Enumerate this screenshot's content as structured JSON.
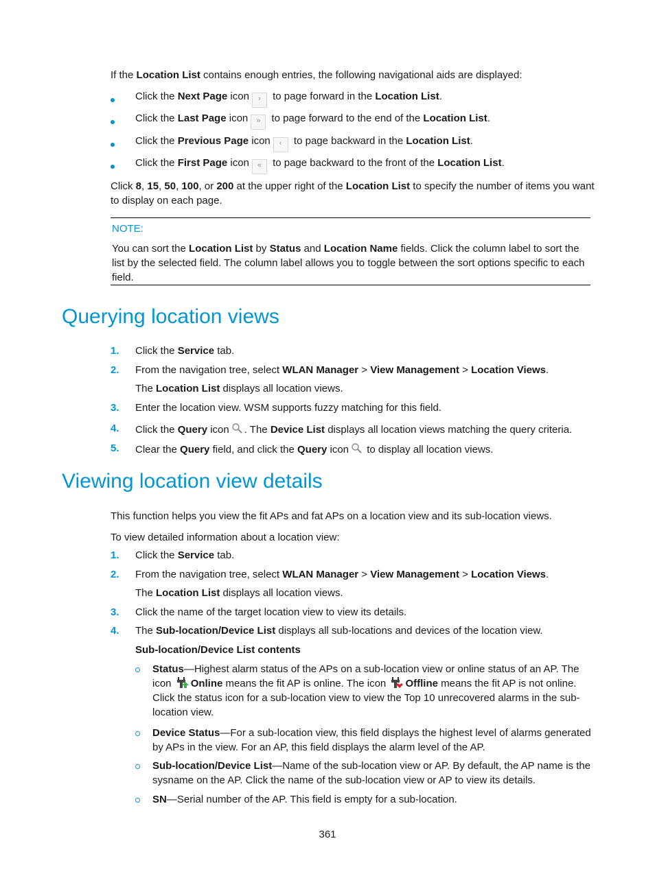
{
  "intro": {
    "pre": "If the ",
    "bold": "Location List",
    "post": " contains enough entries, the following navigational aids are displayed:"
  },
  "nav_bullets": [
    {
      "pre": "Click the ",
      "bold": "Next Page",
      "mid": " icon",
      "icon": "›",
      "icon_name": "next-page-icon",
      "post": " to page forward in the ",
      "bold2": "Location List",
      "end": "."
    },
    {
      "pre": "Click the ",
      "bold": "Last Page",
      "mid": " icon",
      "icon": "»",
      "icon_name": "last-page-icon",
      "post": " to page forward to the end of the ",
      "bold2": "Location List",
      "end": "."
    },
    {
      "pre": "Click the ",
      "bold": "Previous Page",
      "mid": " icon",
      "icon": "‹",
      "icon_name": "previous-page-icon",
      "post": " to page backward in the ",
      "bold2": "Location List",
      "end": "."
    },
    {
      "pre": "Click the ",
      "bold": "First Page",
      "mid": " icon",
      "icon": "«",
      "icon_name": "first-page-icon",
      "post": " to page backward to the front of the ",
      "bold2": "Location List",
      "end": "."
    }
  ],
  "page_size": {
    "pre": "Click ",
    "options": [
      "8",
      "15",
      "50",
      "100",
      "200"
    ],
    "or": " or ",
    "mid": " at the upper right of the ",
    "bold": "Location List",
    "post": " to specify the number of items you want to display on each page."
  },
  "note": {
    "label": "NOTE:",
    "t1": "You can sort the ",
    "b1": "Location List",
    "t2": " by ",
    "b2": "Status",
    "t3": " and ",
    "b3": "Location Name",
    "t4": " fields. Click the column label to sort the list by the selected field. The column label allows you to toggle between the sort options specific to each field."
  },
  "section1": {
    "title": "Querying location views",
    "steps": [
      {
        "num": "1.",
        "t1": "Click the ",
        "b1": "Service",
        "t2": " tab."
      },
      {
        "num": "2.",
        "t1": "From the navigation tree, select ",
        "b1": "WLAN Manager",
        "t2": " > ",
        "b2": "View Management",
        "t3": " > ",
        "b3": "Location Views",
        "t4": "."
      },
      {
        "num": "",
        "t1": "The ",
        "b1": "Location List",
        "t2": " displays all location views."
      },
      {
        "num": "3.",
        "t1": "Enter the location view. WSM supports fuzzy matching for this field."
      },
      {
        "num": "4.",
        "t1": "Click the ",
        "b1": "Query",
        "t2": " icon",
        "t3": ". The ",
        "b3": "Device List",
        "t4": " displays all location views matching the query criteria."
      },
      {
        "num": "5.",
        "t1": "Clear the ",
        "b1": "Query",
        "t2": " field, and click the ",
        "b2": "Query",
        "t3": " icon",
        "t4": " to display all location views."
      }
    ]
  },
  "section2": {
    "title": "Viewing location view details",
    "para1": "This function helps you view the fit APs and fat APs on a location view and its sub-location views.",
    "para2": "To view detailed information about a location view:",
    "steps": [
      {
        "num": "1.",
        "t1": "Click the ",
        "b1": "Service",
        "t2": " tab."
      },
      {
        "num": "2.",
        "t1": "From the navigation tree, select ",
        "b1": "WLAN Manager",
        "t2": " > ",
        "b2": "View Management",
        "t3": " > ",
        "b3": "Location Views",
        "t4": "."
      },
      {
        "num": "",
        "t1": "The ",
        "b1": "Location List",
        "t2": " displays all location views."
      },
      {
        "num": "3.",
        "t1": "Click the name of the target location view to view its details."
      },
      {
        "num": "4.",
        "t1": "The ",
        "b1": "Sub-location/Device List",
        "t2": " displays all sub-locations and devices of the location view."
      }
    ],
    "contents_heading": "Sub-location/Device List contents",
    "fields": [
      {
        "bold": "Status",
        "t1": "—Highest alarm status of the APs on a sub-location view or online status of an AP. The icon ",
        "b_online": "Online",
        "t2": " means the fit AP is online. The icon ",
        "b_offline": "Offline",
        "t3": " means the fit AP is not online. Click the status icon for a sub-location view to view the Top 10 unrecovered alarms in the sub-location view."
      },
      {
        "bold": "Device Status",
        "t1": "—For a sub-location view, this field displays the highest level of alarms generated by APs in the view. For an AP, this field displays the alarm level of the AP."
      },
      {
        "bold": "Sub-location/Device List",
        "t1": "—Name of the sub-location view or AP. By default, the AP name is the sysname on the AP. Click the name of the sub-location view or AP to view its details."
      },
      {
        "bold": "SN",
        "t1": "—Serial number of the AP. This field is empty for a sub-location."
      }
    ]
  },
  "page_number": "361",
  "colors": {
    "accent": "#0096d6",
    "online": "#3cb34a",
    "offline": "#e0202a"
  }
}
